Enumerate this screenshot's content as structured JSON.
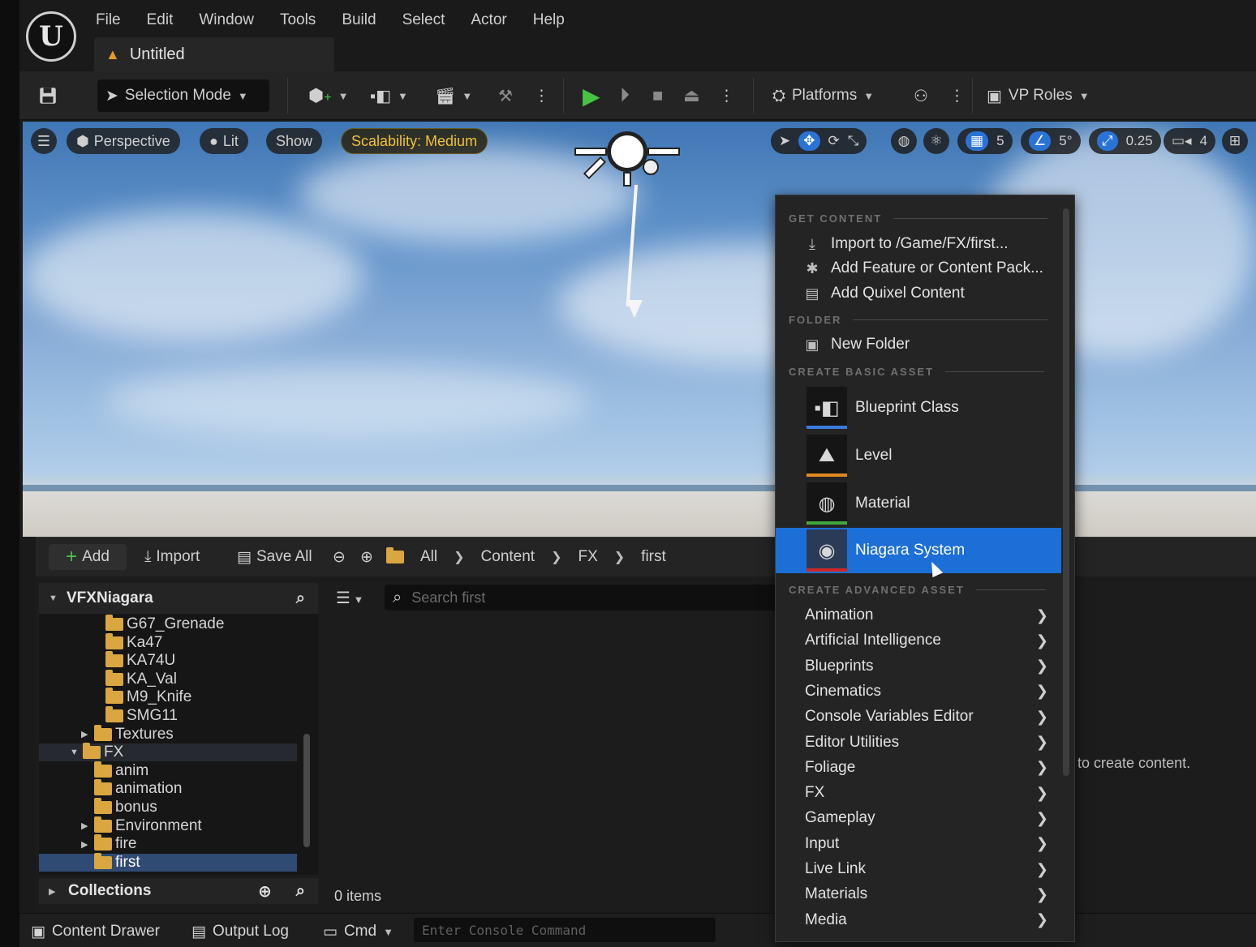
{
  "app": {
    "logo": "ue-logo",
    "menu": [
      "File",
      "Edit",
      "Window",
      "Tools",
      "Build",
      "Select",
      "Actor",
      "Help"
    ],
    "document_tab": "Untitled"
  },
  "toolbar": {
    "selection_mode": "Selection Mode",
    "platforms": "Platforms",
    "vp_roles": "VP Roles"
  },
  "viewport": {
    "perspective": "Perspective",
    "lit": "Lit",
    "show": "Show",
    "scalability": "Scalability: Medium",
    "grid_snap": "5",
    "rotation_snap": "5°",
    "scale_snap": "0.25",
    "camera_speed": "4"
  },
  "content_browser": {
    "add": "Add",
    "import": "Import",
    "save_all": "Save All",
    "breadcrumb": [
      "All",
      "Content",
      "FX",
      "first"
    ],
    "tree_root": "VFXNiagara",
    "tree": [
      {
        "label": "G67_Grenade",
        "indent": 3
      },
      {
        "label": "Ka47",
        "indent": 3
      },
      {
        "label": "KA74U",
        "indent": 3
      },
      {
        "label": "KA_Val",
        "indent": 3
      },
      {
        "label": "M9_Knife",
        "indent": 3
      },
      {
        "label": "SMG11",
        "indent": 3
      },
      {
        "label": "Textures",
        "indent": 2
      },
      {
        "label": "FX",
        "indent": 1
      },
      {
        "label": "anim",
        "indent": 2
      },
      {
        "label": "animation",
        "indent": 2
      },
      {
        "label": "bonus",
        "indent": 2
      },
      {
        "label": "Environment",
        "indent": 2
      },
      {
        "label": "fire",
        "indent": 2
      },
      {
        "label": "first",
        "indent": 2
      }
    ],
    "collections": "Collections",
    "search_placeholder": "Search first",
    "items_count": "0 items",
    "drop_hint": "to create content."
  },
  "statusbar": {
    "content_drawer": "Content Drawer",
    "output_log": "Output Log",
    "cmd": "Cmd",
    "console_placeholder": "Enter Console Command"
  },
  "dropdown": {
    "sections": {
      "get_content": "GET CONTENT",
      "folder": "FOLDER",
      "create_basic": "CREATE BASIC ASSET",
      "create_advanced": "CREATE ADVANCED ASSET"
    },
    "get_content_items": [
      "Import to /Game/FX/first...",
      "Add Feature or Content Pack...",
      "Add Quixel Content"
    ],
    "new_folder": "New Folder",
    "basic_assets": [
      {
        "label": "Blueprint Class",
        "color": "#3a7be0"
      },
      {
        "label": "Level",
        "color": "#e08a1e"
      },
      {
        "label": "Material",
        "color": "#41a83e"
      },
      {
        "label": "Niagara System",
        "color": "#d02626"
      }
    ],
    "advanced": [
      "Animation",
      "Artificial Intelligence",
      "Blueprints",
      "Cinematics",
      "Console Variables Editor",
      "Editor Utilities",
      "Foliage",
      "FX",
      "Gameplay",
      "Input",
      "Live Link",
      "Materials",
      "Media"
    ]
  }
}
